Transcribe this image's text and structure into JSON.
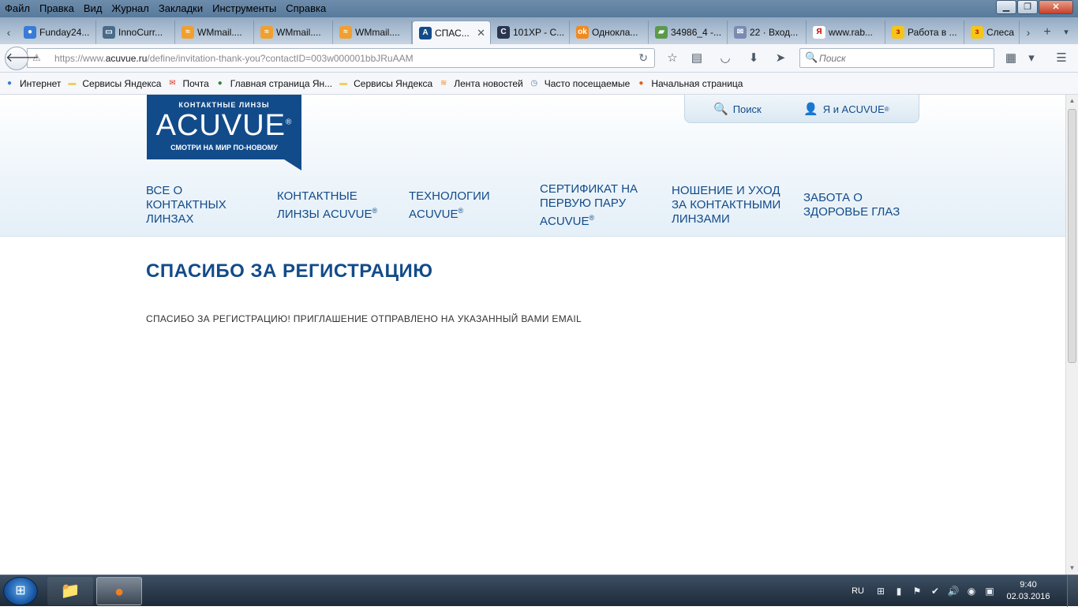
{
  "menubar": {
    "items": [
      "Файл",
      "Правка",
      "Вид",
      "Журнал",
      "Закладки",
      "Инструменты",
      "Справка"
    ]
  },
  "tabs": [
    {
      "label": "Funday24...",
      "icon": "globe-icon",
      "color": "#3a7bd5",
      "active": false
    },
    {
      "label": "InnoCurr...",
      "icon": "monitor-icon",
      "color": "#4a6b8a",
      "active": false
    },
    {
      "label": "WMmail....",
      "icon": "wmmail-icon",
      "color": "#f0a030",
      "active": false
    },
    {
      "label": "WMmail....",
      "icon": "wmmail-icon",
      "color": "#f0a030",
      "active": false
    },
    {
      "label": "WMmail....",
      "icon": "wmmail-icon",
      "color": "#f0a030",
      "active": false
    },
    {
      "label": "СПАС...",
      "icon": "acuvue-icon",
      "color": "#124b8a",
      "active": true
    },
    {
      "label": "101XP - С...",
      "icon": "101xp-icon",
      "color": "#2a3550",
      "active": false
    },
    {
      "label": "Однокла...",
      "icon": "odnoklassniki-icon",
      "color": "#f08a20",
      "active": false
    },
    {
      "label": "34986_4 -...",
      "icon": "image-icon",
      "color": "#5a9a4a",
      "active": false
    },
    {
      "label": "22 · Вход...",
      "icon": "mail-icon",
      "color": "#7a8ab0",
      "active": false
    },
    {
      "label": "www.rab...",
      "icon": "yandex-icon",
      "color": "#ffffff",
      "active": false
    },
    {
      "label": "Работа в ...",
      "icon": "yandex-zen-icon",
      "color": "#f5c518",
      "active": false
    },
    {
      "label": "Слеса",
      "icon": "yandex-zen-icon",
      "color": "#f5c518",
      "active": false
    }
  ],
  "navbar": {
    "url_prefix": "https://www.",
    "url_domain": "acuvue.ru",
    "url_path": "/define/invitation-thank-you?contactID=003w000001bbJRuAAM",
    "search_placeholder": "Поиск"
  },
  "bookmarks": [
    {
      "label": "Интернет",
      "icon": "globe-icon",
      "color": "#3a7bd5"
    },
    {
      "label": "Сервисы Яндекса",
      "icon": "folder-icon",
      "color": "#f0d060"
    },
    {
      "label": "Почта",
      "icon": "mail-icon",
      "color": "#e03020"
    },
    {
      "label": "Главная страница Ян...",
      "icon": "globe-icon",
      "color": "#2a8a3a"
    },
    {
      "label": "Сервисы Яндекса",
      "icon": "folder-icon",
      "color": "#f0d060"
    },
    {
      "label": "Лента новостей",
      "icon": "rss-icon",
      "color": "#f08a20"
    },
    {
      "label": "Часто посещаемые",
      "icon": "clock-page-icon",
      "color": "#5a7ab0"
    },
    {
      "label": "Начальная страница",
      "icon": "firefox-icon",
      "color": "#e06020"
    }
  ],
  "site": {
    "logo_top": "КОНТАКТНЫЕ ЛИНЗЫ",
    "logo_main": "ACUVUE",
    "logo_reg": "®",
    "logo_tagline": "СМОТРИ НА МИР ПО-НОВОМУ",
    "util_search": "Поиск",
    "util_account": "Я и ACUVUE",
    "reg": "®",
    "nav": [
      {
        "line1": "ВСЕ О",
        "line2": "КОНТАКТНЫХ",
        "line3": "ЛИНЗАХ",
        "reg": false
      },
      {
        "line1": "КОНТАКТНЫЕ",
        "line2": "ЛИНЗЫ ACUVUE",
        "line3": "",
        "reg": true
      },
      {
        "line1": "ТЕХНОЛОГИИ",
        "line2": "ACUVUE",
        "line3": "",
        "reg": true
      },
      {
        "line1": "СЕРТИФИКАТ НА",
        "line2": "ПЕРВУЮ ПАРУ",
        "line3": "ACUVUE",
        "reg": true
      },
      {
        "line1": "НОШЕНИЕ И УХОД",
        "line2": "ЗА КОНТАКТНЫМИ",
        "line3": "ЛИНЗАМИ",
        "reg": false
      },
      {
        "line1": "ЗАБОТА О",
        "line2": "ЗДОРОВЬЕ ГЛАЗ",
        "line3": "",
        "reg": false
      }
    ],
    "page_title": "СПАСИБО ЗА РЕГИСТРАЦИЮ",
    "page_body": "СПАСИБО ЗА РЕГИСТРАЦИЮ! ПРИГЛАШЕНИЕ ОТПРАВЛЕНО НА УКАЗАННЫЙ ВАМИ EMAIL"
  },
  "taskbar": {
    "lang": "RU",
    "time": "9:40",
    "date": "02.03.2016"
  },
  "colors": {
    "brand": "#124b8a",
    "header_bg": "#e4eff7"
  }
}
